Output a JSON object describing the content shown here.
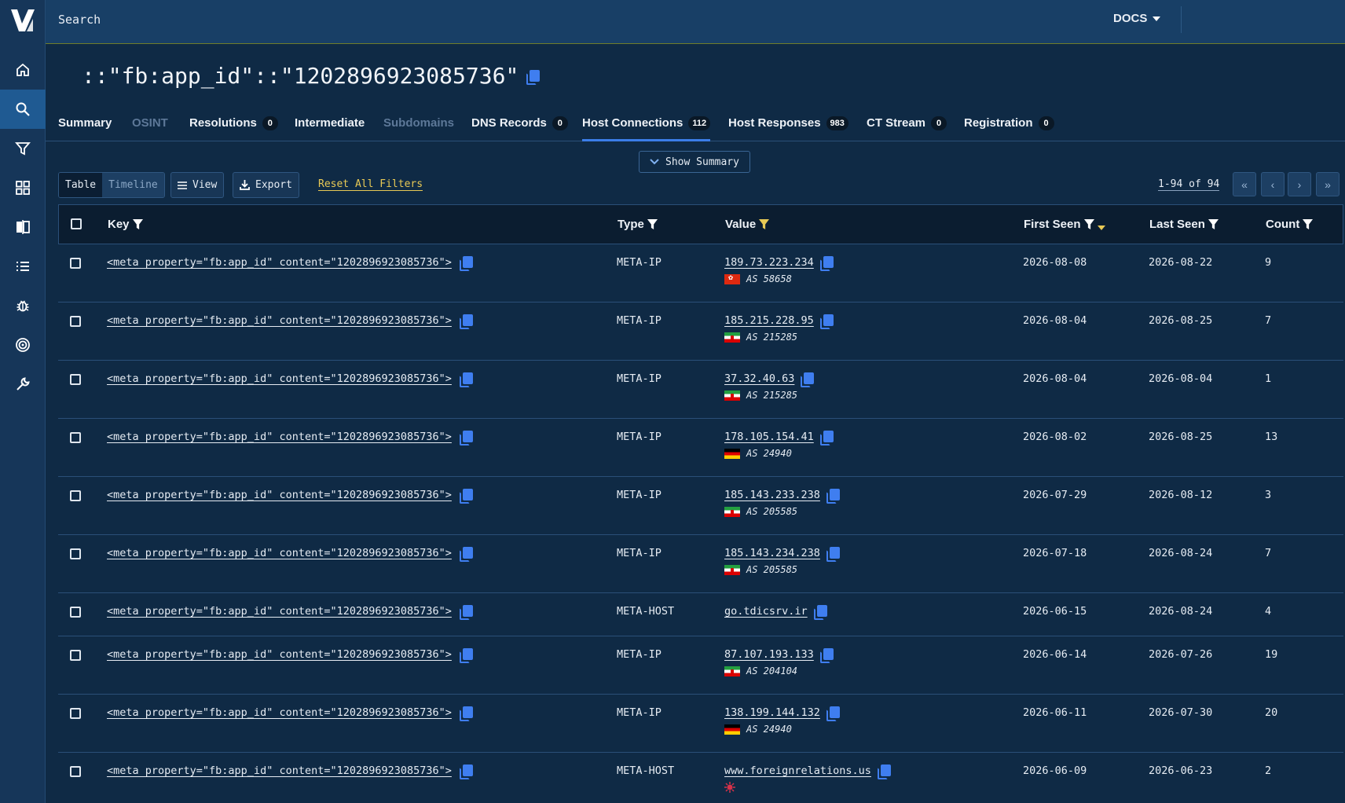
{
  "topbar": {
    "search_label": "Search",
    "docs_label": "DOCS"
  },
  "page": {
    "title": "::\"fb:app_id\"::\"1202896923085736\""
  },
  "tabs": [
    {
      "label": "Summary",
      "badge": ""
    },
    {
      "label": "OSINT",
      "badge": ""
    },
    {
      "label": "Resolutions",
      "badge": "0"
    },
    {
      "label": "Intermediate",
      "badge": ""
    },
    {
      "label": "Subdomains",
      "badge": ""
    },
    {
      "label": "DNS Records",
      "badge": "0"
    },
    {
      "label": "Host Connections",
      "badge": "112"
    },
    {
      "label": "Host Responses",
      "badge": "983"
    },
    {
      "label": "CT Stream",
      "badge": "0"
    },
    {
      "label": "Registration",
      "badge": "0"
    }
  ],
  "summary_toggle": {
    "label": "Show Summary"
  },
  "toolbar": {
    "view_table": "Table",
    "view_timeline": "Timeline",
    "view_label": "View",
    "export_label": "Export",
    "reset_label": "Reset All Filters",
    "pager_text": "1-94 of 94"
  },
  "table": {
    "columns": {
      "key": "Key",
      "type": "Type",
      "value": "Value",
      "first_seen": "First Seen",
      "last_seen": "Last Seen",
      "count": "Count"
    },
    "rows": [
      {
        "key": "<meta property=\"fb:app_id\" content=\"1202896923085736\">",
        "type": "META-IP",
        "value": "189.73.223.234",
        "flag": "hk",
        "asn": "AS 58658",
        "first_seen": "2026-08-08",
        "last_seen": "2026-08-22",
        "count": "9"
      },
      {
        "key": "<meta property=\"fb:app_id\" content=\"1202896923085736\">",
        "type": "META-IP",
        "value": "185.215.228.95",
        "flag": "ir",
        "asn": "AS 215285",
        "first_seen": "2026-08-04",
        "last_seen": "2026-08-25",
        "count": "7"
      },
      {
        "key": "<meta property=\"fb:app_id\" content=\"1202896923085736\">",
        "type": "META-IP",
        "value": "37.32.40.63",
        "flag": "ir",
        "asn": "AS 215285",
        "first_seen": "2026-08-04",
        "last_seen": "2026-08-04",
        "count": "1"
      },
      {
        "key": "<meta property=\"fb:app_id\" content=\"1202896923085736\">",
        "type": "META-IP",
        "value": "178.105.154.41",
        "flag": "de",
        "asn": "AS 24940",
        "first_seen": "2026-08-02",
        "last_seen": "2026-08-25",
        "count": "13"
      },
      {
        "key": "<meta property=\"fb:app_id\" content=\"1202896923085736\">",
        "type": "META-IP",
        "value": "185.143.233.238",
        "flag": "ir",
        "asn": "AS 205585",
        "first_seen": "2026-07-29",
        "last_seen": "2026-08-12",
        "count": "3"
      },
      {
        "key": "<meta property=\"fb:app_id\" content=\"1202896923085736\">",
        "type": "META-IP",
        "value": "185.143.234.238",
        "flag": "ir",
        "asn": "AS 205585",
        "first_seen": "2026-07-18",
        "last_seen": "2026-08-24",
        "count": "7"
      },
      {
        "key": "<meta property=\"fb:app_id\" content=\"1202896923085736\">",
        "type": "META-HOST",
        "value": "go.tdicsrv.ir",
        "flag": "",
        "asn": "",
        "first_seen": "2026-06-15",
        "last_seen": "2026-08-24",
        "count": "4"
      },
      {
        "key": "<meta property=\"fb:app_id\" content=\"1202896923085736\">",
        "type": "META-IP",
        "value": "87.107.193.133",
        "flag": "ir",
        "asn": "AS 204104",
        "first_seen": "2026-06-14",
        "last_seen": "2026-07-26",
        "count": "19"
      },
      {
        "key": "<meta property=\"fb:app_id\" content=\"1202896923085736\">",
        "type": "META-IP",
        "value": "138.199.144.132",
        "flag": "de",
        "asn": "AS 24940",
        "first_seen": "2026-06-11",
        "last_seen": "2026-07-30",
        "count": "20"
      },
      {
        "key": "<meta property=\"fb:app_id\" content=\"1202896923085736\">",
        "type": "META-HOST",
        "value": "www.foreignrelations.us",
        "flag": "bug",
        "asn": "",
        "first_seen": "2026-06-09",
        "last_seen": "2026-06-23",
        "count": "2"
      }
    ]
  },
  "colors": {
    "accent": "#3b7de8",
    "filter_active": "#e8c955",
    "background": "#0f2a45",
    "sidebar": "#163659"
  },
  "icons": {
    "sidebar": [
      "home-icon",
      "search-icon",
      "filter-icon",
      "grid-icon",
      "compare-icon",
      "list-icon",
      "bug-icon",
      "target-icon",
      "wrench-icon"
    ]
  }
}
